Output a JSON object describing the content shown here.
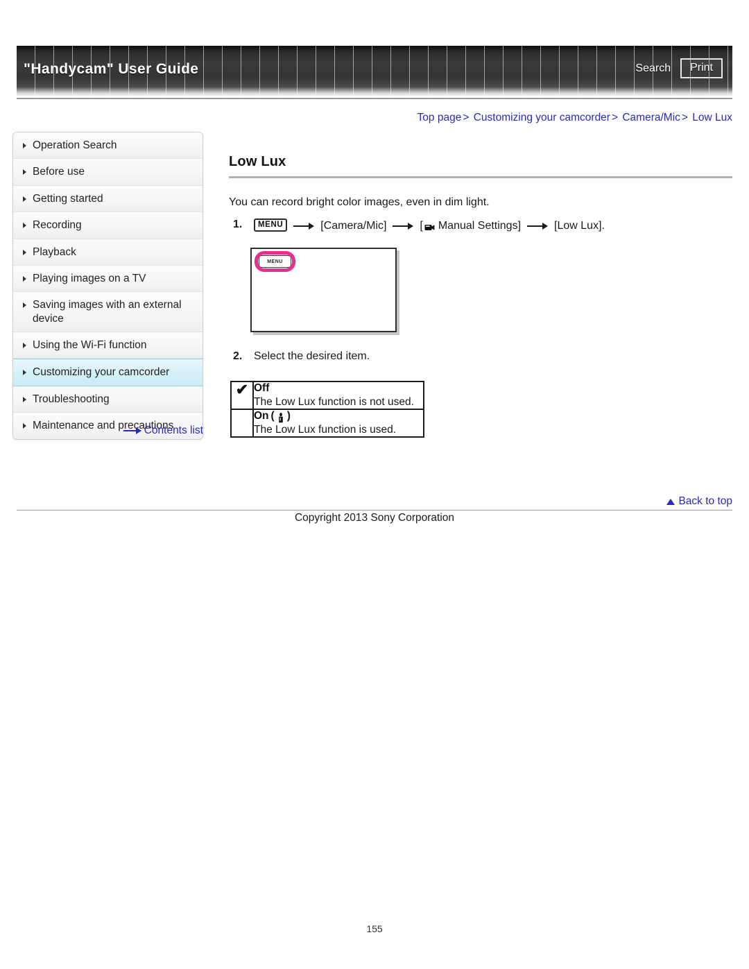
{
  "header": {
    "title": "\"Handycam\" User Guide",
    "search_label": "Search",
    "print_label": "Print"
  },
  "breadcrumb": {
    "items": [
      "Top page",
      "Customizing your camcorder",
      "Camera/Mic",
      "Low Lux"
    ],
    "separator": ">"
  },
  "sidebar": {
    "items": [
      {
        "label": "Operation Search",
        "active": false
      },
      {
        "label": "Before use",
        "active": false
      },
      {
        "label": "Getting started",
        "active": false
      },
      {
        "label": "Recording",
        "active": false
      },
      {
        "label": "Playback",
        "active": false
      },
      {
        "label": "Playing images on a TV",
        "active": false
      },
      {
        "label": "Saving images with an external device",
        "active": false
      },
      {
        "label": "Using the Wi-Fi function",
        "active": false
      },
      {
        "label": "Customizing your camcorder",
        "active": true
      },
      {
        "label": "Troubleshooting",
        "active": false
      },
      {
        "label": "Maintenance and precautions",
        "active": false
      }
    ],
    "contents_list_label": "Contents list",
    "active_highlight_color": "#cdebf5"
  },
  "main": {
    "title": "Low Lux",
    "intro": "You can record bright color images, even in dim light.",
    "steps": [
      {
        "number": "1.",
        "menu_chip": "MENU",
        "part_camera_mic": "[Camera/Mic]",
        "part_manual_open": "[",
        "part_manual_settings": "Manual Settings]",
        "part_low_lux": "[Low Lux]."
      },
      {
        "number": "2.",
        "text": "Select the desired item."
      }
    ],
    "illustration": {
      "menu_button_label": "MENU",
      "highlight_color": "#ec2d8f"
    },
    "options_table": {
      "rows": [
        {
          "checked": true,
          "check_glyph": "✔",
          "name": "Off",
          "icon": "",
          "description": "The Low Lux function is not used."
        },
        {
          "checked": false,
          "check_glyph": "",
          "name": "On",
          "icon": "candle-icon",
          "description": "The Low Lux function is used."
        }
      ]
    }
  },
  "footer": {
    "back_to_top_label": "Back to top",
    "copyright": "Copyright 2013 Sony Corporation",
    "page_number": "155"
  }
}
